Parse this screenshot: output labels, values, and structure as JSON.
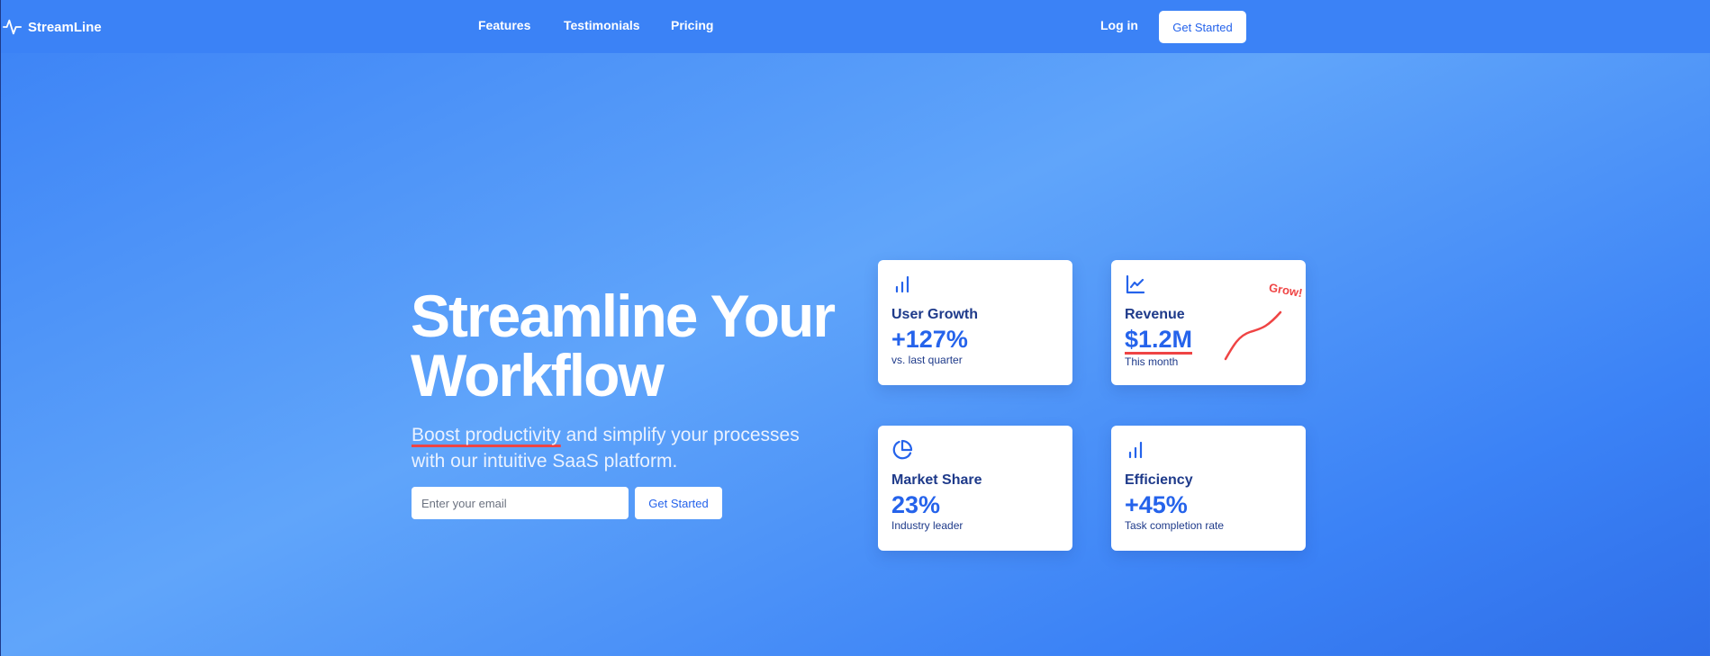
{
  "nav": {
    "brand": "StreamLine",
    "links": [
      {
        "label": "Features"
      },
      {
        "label": "Testimonials"
      },
      {
        "label": "Pricing"
      }
    ],
    "login": "Log in",
    "cta": "Get Started"
  },
  "hero": {
    "title_line1": "Streamline Your",
    "title_line2": "Workflow",
    "subtitle_highlight": "Boost productivity",
    "subtitle_rest": " and simplify your processes with our intuitive SaaS platform.",
    "email_placeholder": "Enter your email",
    "cta": "Get Started"
  },
  "cards": [
    {
      "icon": "bar-chart-icon",
      "label": "User Growth",
      "value": "+127%",
      "note": "vs. last quarter"
    },
    {
      "icon": "line-chart-icon",
      "label": "Revenue",
      "value": "$1.2M",
      "note": "This month",
      "annotation": "Grow!"
    },
    {
      "icon": "pie-chart-icon",
      "label": "Market Share",
      "value": "23%",
      "note": "Industry leader"
    },
    {
      "icon": "bar-chart-icon",
      "label": "Efficiency",
      "value": "+45%",
      "note": "Task completion rate"
    }
  ],
  "colors": {
    "primary": "#3b82f6",
    "accent": "#2563eb",
    "heading": "#1e3a8a",
    "highlight": "#ef4444"
  }
}
